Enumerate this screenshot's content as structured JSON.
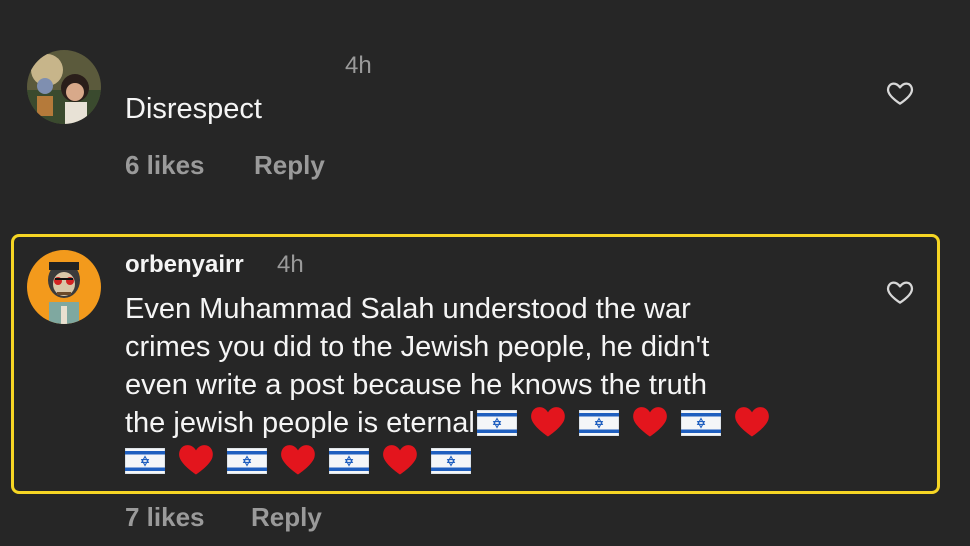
{
  "comments": [
    {
      "username": "",
      "time": "4h",
      "text": "Disrespect",
      "likes": "6 likes",
      "reply": "Reply"
    },
    {
      "username": "orbenyairr",
      "time": "4h",
      "text_lines": [
        "Even Muhammad Salah understood the war",
        "crimes you did to the Jewish people, he didn't",
        "even write a post because he knows the truth",
        "the jewish people is eternal"
      ],
      "emoji_sequence": [
        "israel-flag",
        "red-heart",
        "israel-flag",
        "red-heart",
        "israel-flag",
        "red-heart",
        "israel-flag",
        "red-heart",
        "israel-flag",
        "red-heart",
        "israel-flag",
        "red-heart",
        "israel-flag"
      ],
      "likes": "7 likes",
      "reply": "Reply"
    }
  ],
  "colors": {
    "background": "#262626",
    "highlight": "#f5d524",
    "secondary_text": "#9a9a9a",
    "primary_text": "#f5f5f5"
  }
}
